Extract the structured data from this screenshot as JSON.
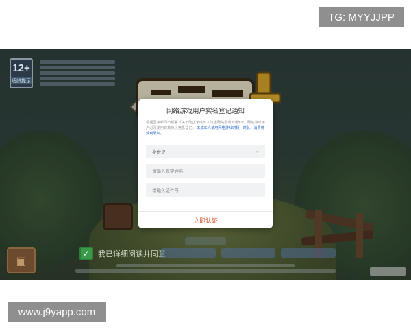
{
  "watermarks": {
    "top": "TG: MYYJJPP",
    "bottom": "www.j9yapp.com"
  },
  "age_badge": {
    "rating": "12+",
    "label": "适龄提示"
  },
  "dialog": {
    "title": "网络游戏用户实名登记通知",
    "description": "根据国家新闻出版署《关于防止未成年人沉迷网络游戏的通知》，网络游戏用户必须使用有效身份信息登记。",
    "notice": "未成年人使用网络游戏时段、时长、消费将受到限制。",
    "id_type_selected": "身份证",
    "name_placeholder": "请输入真实姓名",
    "id_placeholder": "请输入证件号",
    "submit_label": "立即认证"
  },
  "agreement": {
    "text": "我已详细阅读并同意"
  },
  "colors": {
    "accent": "#d9542d",
    "link": "#2d6fd0",
    "check": "#3a9a4a"
  }
}
